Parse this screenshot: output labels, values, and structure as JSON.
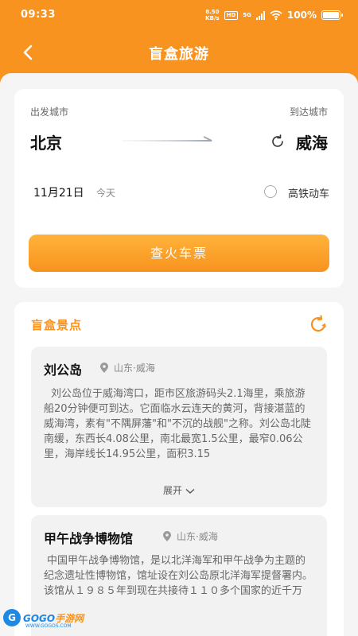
{
  "status_bar": {
    "time": "09:33",
    "speed_value": "8.50",
    "speed_unit": "KB/s",
    "hd": "HD",
    "network": "5G",
    "battery": "100%",
    "battery_level": 1.0
  },
  "header": {
    "title": "盲盒旅游"
  },
  "search": {
    "from_label": "出发城市",
    "to_label": "到达城市",
    "from_city": "北京",
    "to_city": "威海",
    "date": "11月21日",
    "date_hint": "今天",
    "option_label": "高铁动车",
    "button_label": "查火车票"
  },
  "attractions": {
    "title": "盲盒景点",
    "items": [
      {
        "name": "刘公岛",
        "location": "山东·威海",
        "description": "刘公岛位于威海湾口，距市区旅游码头2.1海里，乘旅游船20分钟便可到达。它面临水云连天的黄河，背接湛蓝的威海湾，素有\"不隅屏藩\"和\"不沉的战舰\"之称。刘公岛北陡南缓，东西长4.08公里，南北最宽1.5公里，最窄0.06公里，海岸线长14.95公里，面积3.15",
        "expand_label": "展开"
      },
      {
        "name": "甲午战争博物馆",
        "location": "山东·威海",
        "description": "中国甲午战争博物馆，是以北洋海军和甲午战争为主题的纪念遗址性博物馆，馆址设在刘公岛原北洋海军提督署内。该馆从１９８５年到现在共接待１１０多个国家的近千万"
      }
    ]
  },
  "watermark": {
    "logo": "G",
    "brand_a": "GOGO",
    "brand_b": "手游网",
    "url": "WWW.GOGOS.COM"
  }
}
